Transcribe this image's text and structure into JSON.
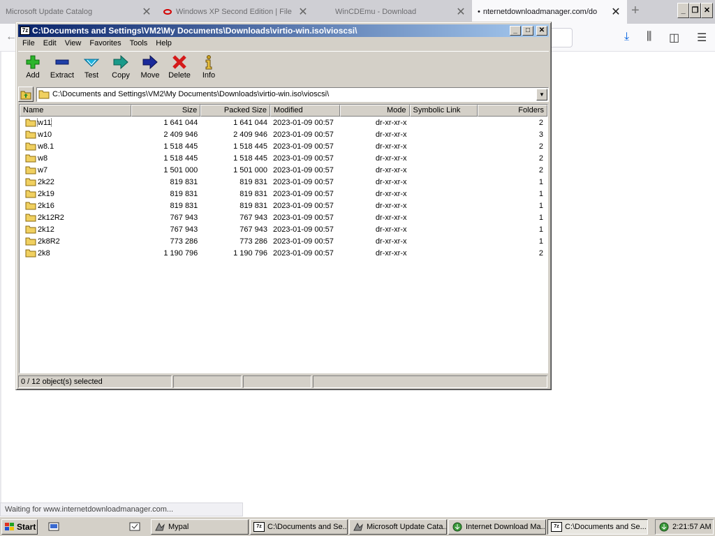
{
  "browser": {
    "tabs": [
      {
        "label": "Microsoft Update Catalog"
      },
      {
        "label": "Windows XP Second Edition | File"
      },
      {
        "label": "WinCDEmu - Download"
      },
      {
        "label": "nternetdownloadmanager.com/do"
      }
    ],
    "status_text": "Waiting for www.internetdownloadmanager.com..."
  },
  "window": {
    "title": "C:\\Documents and Settings\\VM2\\My Documents\\Downloads\\virtio-win.iso\\vioscsi\\",
    "app_icon_text": "7z",
    "menu": [
      "File",
      "Edit",
      "View",
      "Favorites",
      "Tools",
      "Help"
    ],
    "toolbar": [
      {
        "label": "Add",
        "icon": "plus-icon",
        "color": "#2cb52c"
      },
      {
        "label": "Extract",
        "icon": "minus-icon",
        "color": "#1f3fa8"
      },
      {
        "label": "Test",
        "icon": "check-icon",
        "color": "#1db4e0"
      },
      {
        "label": "Copy",
        "icon": "copy-arrow-icon",
        "color": "#1a9a8a"
      },
      {
        "label": "Move",
        "icon": "move-arrow-icon",
        "color": "#1a2a9a"
      },
      {
        "label": "Delete",
        "icon": "x-delete-icon",
        "color": "#d41a1a"
      },
      {
        "label": "Info",
        "icon": "info-icon",
        "color": "#c8a020"
      }
    ],
    "address": "C:\\Documents and Settings\\VM2\\My Documents\\Downloads\\virtio-win.iso\\vioscsi\\",
    "columns": [
      "Name",
      "Size",
      "Packed Size",
      "Modified",
      "Mode",
      "Symbolic Link",
      "Folders"
    ],
    "rows": [
      {
        "name": "w11",
        "size": "1 641 044",
        "packed": "1 641 044",
        "modified": "2023-01-09 00:57",
        "mode": "dr-xr-xr-x",
        "symlink": "",
        "folders": "2"
      },
      {
        "name": "w10",
        "size": "2 409 946",
        "packed": "2 409 946",
        "modified": "2023-01-09 00:57",
        "mode": "dr-xr-xr-x",
        "symlink": "",
        "folders": "3"
      },
      {
        "name": "w8.1",
        "size": "1 518 445",
        "packed": "1 518 445",
        "modified": "2023-01-09 00:57",
        "mode": "dr-xr-xr-x",
        "symlink": "",
        "folders": "2"
      },
      {
        "name": "w8",
        "size": "1 518 445",
        "packed": "1 518 445",
        "modified": "2023-01-09 00:57",
        "mode": "dr-xr-xr-x",
        "symlink": "",
        "folders": "2"
      },
      {
        "name": "w7",
        "size": "1 501 000",
        "packed": "1 501 000",
        "modified": "2023-01-09 00:57",
        "mode": "dr-xr-xr-x",
        "symlink": "",
        "folders": "2"
      },
      {
        "name": "2k22",
        "size": "819 831",
        "packed": "819 831",
        "modified": "2023-01-09 00:57",
        "mode": "dr-xr-xr-x",
        "symlink": "",
        "folders": "1"
      },
      {
        "name": "2k19",
        "size": "819 831",
        "packed": "819 831",
        "modified": "2023-01-09 00:57",
        "mode": "dr-xr-xr-x",
        "symlink": "",
        "folders": "1"
      },
      {
        "name": "2k16",
        "size": "819 831",
        "packed": "819 831",
        "modified": "2023-01-09 00:57",
        "mode": "dr-xr-xr-x",
        "symlink": "",
        "folders": "1"
      },
      {
        "name": "2k12R2",
        "size": "767 943",
        "packed": "767 943",
        "modified": "2023-01-09 00:57",
        "mode": "dr-xr-xr-x",
        "symlink": "",
        "folders": "1"
      },
      {
        "name": "2k12",
        "size": "767 943",
        "packed": "767 943",
        "modified": "2023-01-09 00:57",
        "mode": "dr-xr-xr-x",
        "symlink": "",
        "folders": "1"
      },
      {
        "name": "2k8R2",
        "size": "773 286",
        "packed": "773 286",
        "modified": "2023-01-09 00:57",
        "mode": "dr-xr-xr-x",
        "symlink": "",
        "folders": "1"
      },
      {
        "name": "2k8",
        "size": "1 190 796",
        "packed": "1 190 796",
        "modified": "2023-01-09 00:57",
        "mode": "dr-xr-xr-x",
        "symlink": "",
        "folders": "2"
      }
    ],
    "status": "0 / 12 object(s) selected"
  },
  "taskbar": {
    "start_label": "Start",
    "tasks": [
      {
        "label": "Mypal",
        "icon": "mypal-icon"
      },
      {
        "label": "C:\\Documents and Se...",
        "icon": "7zip-icon"
      },
      {
        "label": "Microsoft Update Cata...",
        "icon": "globe-icon"
      },
      {
        "label": "Internet Download Ma...",
        "icon": "idm-icon"
      },
      {
        "label": "C:\\Documents and Se...",
        "icon": "7zip-icon"
      }
    ],
    "clock": "2:21:57 AM"
  }
}
